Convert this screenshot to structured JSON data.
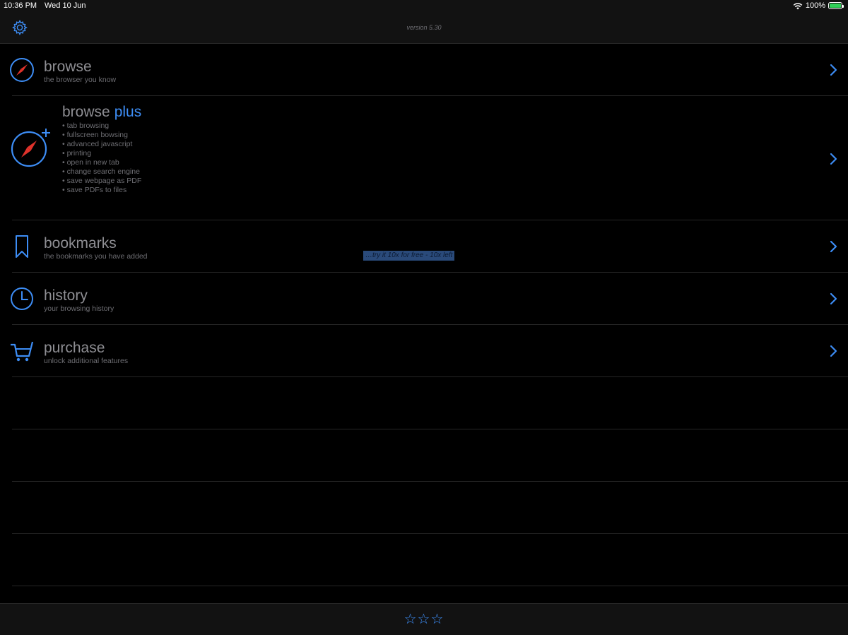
{
  "status_bar": {
    "time": "10:36 PM",
    "date": "Wed 10 Jun",
    "battery": "100%",
    "battery_level": 1.0
  },
  "nav": {
    "version": "version 5.30",
    "settings_icon": "gear-icon"
  },
  "rows": {
    "browse": {
      "title": "browse",
      "subtitle": "the browser you know",
      "icon": "compass-icon"
    },
    "browse_plus": {
      "title": "browse",
      "title_accent": "plus",
      "icon": "compass-plus-icon",
      "features": [
        "• tab browsing",
        "• fullscreen bowsing",
        "• advanced javascript",
        "• printing",
        "• open in new tab",
        "• change search engine",
        "• save webpage as PDF",
        "• save PDFs to files"
      ],
      "trial": "…try it 10x for free - 10x left"
    },
    "bookmarks": {
      "title": "bookmarks",
      "subtitle": "the bookmarks you have added",
      "icon": "bookmark-icon"
    },
    "history": {
      "title": "history",
      "subtitle": "your browsing history",
      "icon": "clock-icon"
    },
    "purchase": {
      "title": "purchase",
      "subtitle": "unlock additional features",
      "icon": "cart-icon"
    }
  },
  "bottom": {
    "rating": "☆☆☆"
  },
  "colors": {
    "accent": "#3d8df5",
    "needle": "#e0322b",
    "background": "#000000",
    "bar": "#121212"
  }
}
